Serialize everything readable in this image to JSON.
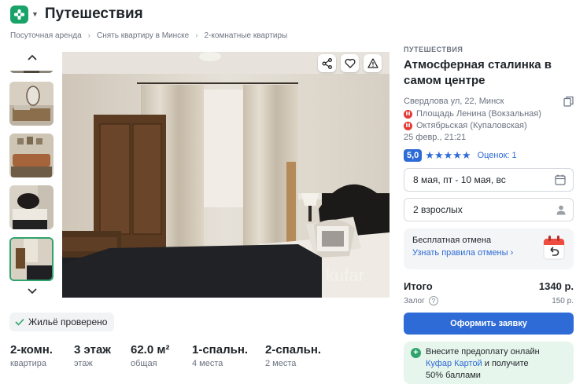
{
  "app": {
    "title": "Путешествия",
    "brand_color": "#1aa368"
  },
  "breadcrumb": [
    "Посуточная аренда",
    "Снять квартиру в Минске",
    "2-комнатные квартиры"
  ],
  "gallery": {
    "thumb_count": 5,
    "active_thumb": 4,
    "watermark": "kufar"
  },
  "verified": {
    "label": "Жильё проверено"
  },
  "specs": [
    {
      "value": "2-комн.",
      "label": "квартира"
    },
    {
      "value": "3 этаж",
      "label": "этаж"
    },
    {
      "value": "62.0 м²",
      "label": "общая"
    },
    {
      "value": "1-спальн.",
      "label": "4 места"
    },
    {
      "value": "2-спальн.",
      "label": "2 места"
    }
  ],
  "listing": {
    "category": "ПУТЕШЕСТВИЯ",
    "title": "Атмосферная сталинка в самом центре",
    "address": "Свердлова ул, 22, Минск",
    "metro": [
      "Площадь Ленина (Вокзальная)",
      "Октябрьская (Купаловская)"
    ],
    "date": "25 февр., 21:21",
    "rating": "5,0",
    "stars": 5,
    "reviews": "Оценок: 1"
  },
  "booking": {
    "dates": "8 мая, пт - 10 мая, вс",
    "guests": "2 взрослых",
    "cancel_title": "Бесплатная отмена",
    "cancel_link": "Узнать правила отмены",
    "total_label": "Итого",
    "total_value": "1340 р.",
    "deposit_label": "Залог",
    "deposit_value": "150 р.",
    "submit_label": "Оформить заявку"
  },
  "promo": {
    "line1": "Внесите предоплату онлайн",
    "link": "Куфар Картой",
    "line2": " и получите",
    "line3": "50% баллами"
  },
  "colors": {
    "accent": "#2e6bd6",
    "metro": "#e53935",
    "green": "#2fa36b"
  }
}
